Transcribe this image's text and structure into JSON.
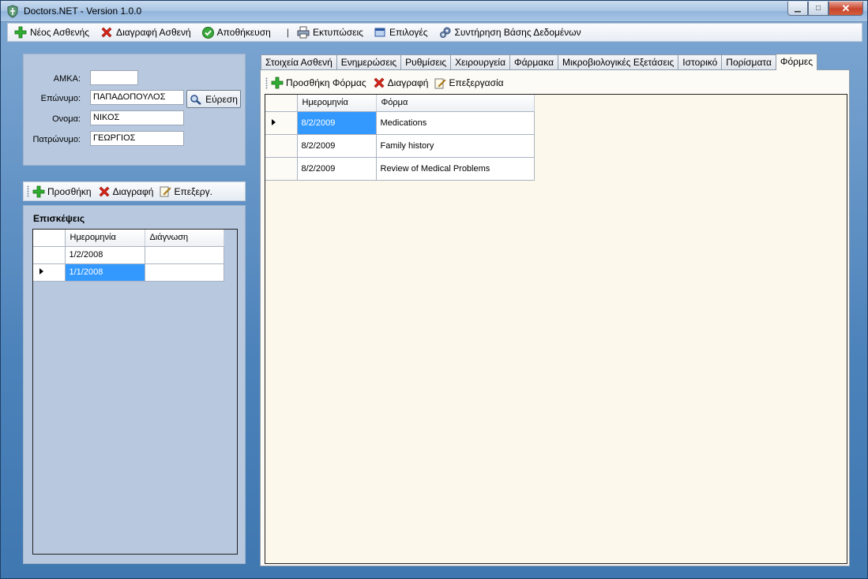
{
  "window": {
    "title": "Doctors.NET - Version 1.0.0"
  },
  "main_toolbar": {
    "new_patient": "Νέος Ασθενής",
    "delete_patient": "Διαγραφή Ασθενή",
    "save": "Αποθήκευση",
    "separator": "|",
    "prints": "Εκτυπώσεις",
    "options": "Επιλογές",
    "db_maintenance": "Συντήρηση Βάσης Δεδομένων"
  },
  "patient": {
    "amka_label": "ΑΜΚΑ:",
    "amka_value": "",
    "surname_label": "Επώνυμο:",
    "surname_value": "ΠΑΠΑΔΟΠΟΥΛΟΣ",
    "name_label": "Ονομα:",
    "name_value": "ΝΙΚΟΣ",
    "father_label": "Πατρώνυμο:",
    "father_value": "ΓΕΩΡΓΙΟΣ",
    "find_button": "Εύρεση"
  },
  "visits_toolbar": {
    "add": "Προσθήκη",
    "delete": "Διαγραφή",
    "edit": "Επεξεργ."
  },
  "visits": {
    "title": "Επισκέψεις",
    "columns": [
      "Ημερομηνία",
      "Διάγνωση"
    ],
    "rows": [
      {
        "date": "1/2/2008",
        "diagnosis": ""
      },
      {
        "date": "1/1/2008",
        "diagnosis": ""
      }
    ]
  },
  "tabs": [
    "Στοιχεία Ασθενή",
    "Ενημερώσεις",
    "Ρυθμίσεις",
    "Χειρουργεία",
    "Φάρμακα",
    "Μικροβιολογικές Εξετάσεις",
    "Ιστορικό",
    "Πορίσματα",
    "Φόρμες"
  ],
  "forms_toolbar": {
    "add_form": "Προσθήκη Φόρμας",
    "delete": "Διαγραφή",
    "edit": "Επεξεργασία"
  },
  "forms": {
    "columns": [
      "Ημερομηνία",
      "Φόρμα"
    ],
    "rows": [
      {
        "date": "8/2/2009",
        "form": "Medications"
      },
      {
        "date": "8/2/2009",
        "form": "Family history"
      },
      {
        "date": "8/2/2009",
        "form": "Review of Medical Problems"
      }
    ]
  }
}
